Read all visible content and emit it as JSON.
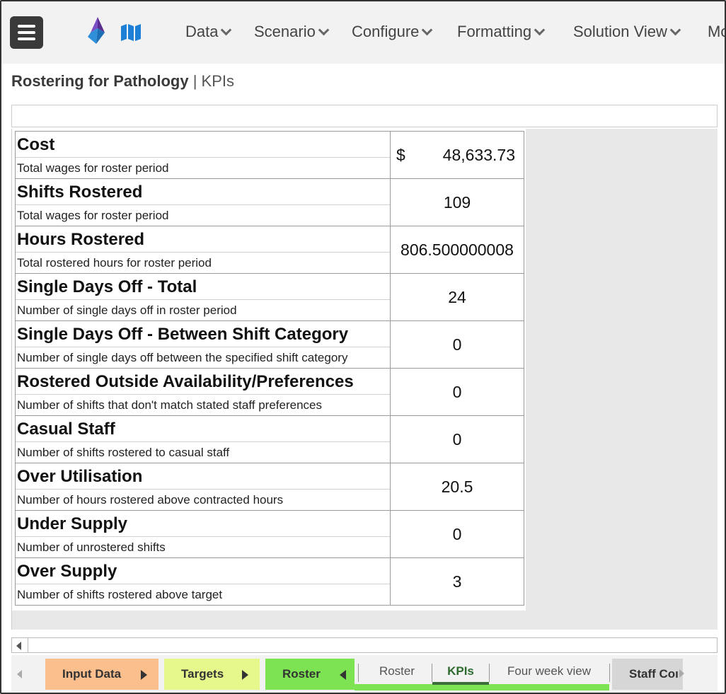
{
  "nav": {
    "menu_items": [
      {
        "label": "Data"
      },
      {
        "label": "Scenario"
      },
      {
        "label": "Configure"
      },
      {
        "label": "Formatting"
      },
      {
        "label": "Solution View"
      },
      {
        "label": "Mo"
      }
    ]
  },
  "header": {
    "app_title": "Rostering for Pathology",
    "separator": "|",
    "page": "KPIs"
  },
  "kpis": [
    {
      "title": "Cost",
      "desc": "Total wages for roster period",
      "currency": "$",
      "value": "48,633.73"
    },
    {
      "title": "Shifts Rostered",
      "desc": "Total wages for roster period",
      "value": "109"
    },
    {
      "title": "Hours Rostered",
      "desc": "Total rostered hours for roster period",
      "value": "806.500000008"
    },
    {
      "title": "Single Days Off - Total",
      "desc": "Number of single days off in roster period",
      "value": "24"
    },
    {
      "title": "Single Days Off - Between Shift Category",
      "desc": "Number of single days off between the specified shift category",
      "value": "0"
    },
    {
      "title": "Rostered Outside Availability/Preferences",
      "desc": "Number of shifts that don't match stated staff preferences",
      "value": "0"
    },
    {
      "title": "Casual Staff",
      "desc": "Number of shifts rostered to casual staff",
      "value": "0"
    },
    {
      "title": "Over Utilisation",
      "desc": "Number of hours rostered above contracted hours",
      "value": "20.5"
    },
    {
      "title": "Under Supply",
      "desc": "Number of unrostered shifts",
      "value": "0"
    },
    {
      "title": "Over Supply",
      "desc": "Number of shifts rostered above target",
      "value": "3"
    }
  ],
  "tabs": {
    "groups": [
      {
        "label": "Input Data",
        "color": "#fbbf8e"
      },
      {
        "label": "Targets",
        "color": "#e6f78c"
      },
      {
        "label": "Roster",
        "color": "#7de352"
      }
    ],
    "sheets": [
      {
        "label": "Roster"
      },
      {
        "label": "KPIs",
        "active": true
      },
      {
        "label": "Four week view"
      }
    ],
    "trailing": {
      "label": "Staff Coı"
    }
  },
  "colors": {
    "accent_green": "#7de352",
    "active_tab_text": "#2e6b2e",
    "logo_blue": "#2f8fd8",
    "logo_purple": "#5b2d91"
  }
}
